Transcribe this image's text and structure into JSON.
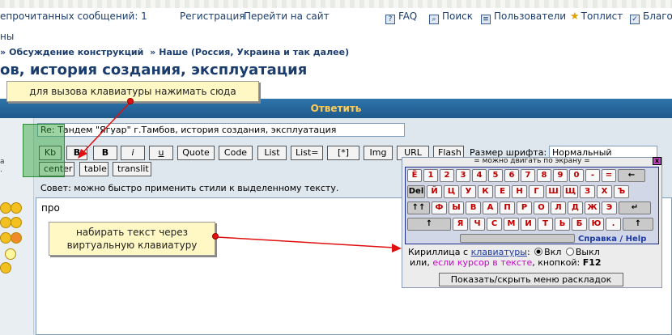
{
  "topbar": {
    "unread": "епрочитанных сообщений: 1",
    "register": "Регистрация",
    "goto_site": "Перейти на сайт",
    "faq": "FAQ",
    "search": "Поиск",
    "users": "Пользователи",
    "toplist": "Топлист",
    "thanks": "Благо",
    "faq_icon": "help-icon",
    "search_icon": "magnifier-icon",
    "users_icon": "users-icon",
    "toplist_icon": "star-icon"
  },
  "nav": {
    "themes": "ны"
  },
  "breadcrumb": {
    "sep": "»",
    "part1": "Обсуждение конструкций",
    "part2": "Наше (Россия, Украина и так далее)"
  },
  "topic_title": "ов, история создания, эксплуатация",
  "reply_label": "Ответить",
  "left_note": [
    "а",
    "."
  ],
  "subject_value": "Re: Тандем \"Ягуар\" г.Тамбов, история создания, эксплуатация",
  "toolbar": {
    "buttons": [
      "Kb",
      "B",
      "B",
      "i",
      "u",
      "Quote",
      "Code",
      "List",
      "List=",
      "[*]",
      "Img",
      "URL",
      "Flash"
    ],
    "row2": [
      "center",
      "table",
      "translit"
    ],
    "fontsize_label": "Размер шрифта:",
    "fontsize_value": "Нормальный"
  },
  "tip": "Совет: можно быстро применить стили к выделенному тексту.",
  "message_text": "про",
  "callouts": {
    "keyboard_hint": "для вызова клавиатуры нажимать сюда",
    "typing_hint_line1": "набирать текст через",
    "typing_hint_line2": "виртуальную клавиатуру"
  },
  "keyboard": {
    "header": "= можно двигать по экрану =",
    "close": "x",
    "row1": [
      "Ё",
      "1",
      "2",
      "3",
      "4",
      "5",
      "6",
      "7",
      "8",
      "9",
      "0",
      "-",
      "=",
      "←"
    ],
    "row2": [
      "Del",
      "Й",
      "Ц",
      "У",
      "К",
      "Е",
      "Н",
      "Г",
      "Ш",
      "Щ",
      "З",
      "Х",
      "Ъ"
    ],
    "row3": [
      "↑↑",
      "Ф",
      "Ы",
      "В",
      "А",
      "П",
      "Р",
      "О",
      "Л",
      "Д",
      "Ж",
      "Э",
      "↵"
    ],
    "row4": [
      "↑",
      "Я",
      "Ч",
      "С",
      "М",
      "И",
      "Т",
      "Ь",
      "Б",
      "Ю",
      ".",
      "↑"
    ],
    "help": "Справка / Help",
    "cyr_label": "Кириллица с",
    "cyr_link": "клавиатуры",
    "on": "Вкл",
    "off": "Выкл",
    "or_label": "или,",
    "or_cursor": "если курсор в тексте",
    "or_key": ", кнопкой:",
    "key_name": "F12",
    "toggle_button": "Показать/скрыть меню раскладок"
  }
}
